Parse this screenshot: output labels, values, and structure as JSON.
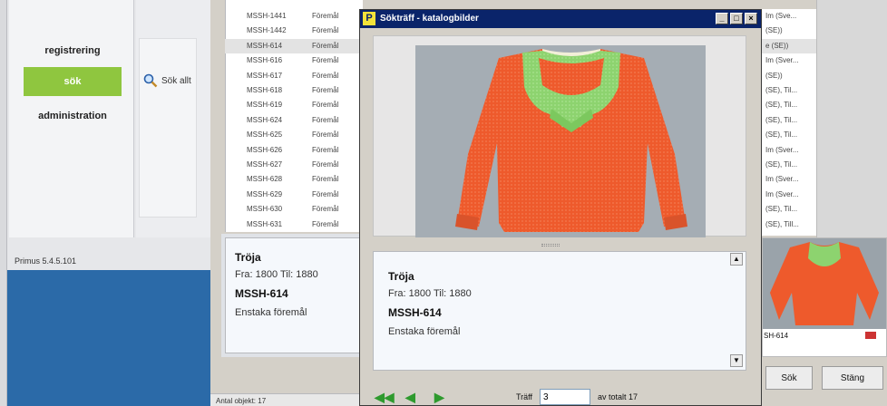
{
  "sidebar": {
    "items": [
      {
        "label": "registrering"
      },
      {
        "label": "sök"
      },
      {
        "label": "administration"
      }
    ],
    "quick_search_label": "Sök allt",
    "version": "Primus 5.4.5.101"
  },
  "list": {
    "rows": [
      {
        "id": "MSSH-1441",
        "type": "Föremål"
      },
      {
        "id": "MSSH-1442",
        "type": "Föremål"
      },
      {
        "id": "MSSH-614",
        "type": "Föremål"
      },
      {
        "id": "MSSH-616",
        "type": "Föremål"
      },
      {
        "id": "MSSH-617",
        "type": "Föremål"
      },
      {
        "id": "MSSH-618",
        "type": "Föremål"
      },
      {
        "id": "MSSH-619",
        "type": "Föremål"
      },
      {
        "id": "MSSH-624",
        "type": "Föremål"
      },
      {
        "id": "MSSH-625",
        "type": "Föremål"
      },
      {
        "id": "MSSH-626",
        "type": "Föremål"
      },
      {
        "id": "MSSH-627",
        "type": "Föremål"
      },
      {
        "id": "MSSH-628",
        "type": "Föremål"
      },
      {
        "id": "MSSH-629",
        "type": "Föremål"
      },
      {
        "id": "MSSH-630",
        "type": "Föremål"
      },
      {
        "id": "MSSH-631",
        "type": "Föremål"
      }
    ],
    "count_label": "Antal objekt: 17"
  },
  "detail": {
    "title": "Tröja",
    "dates": "Fra: 1800 Til: 1880",
    "id": "MSSH-614",
    "type": "Enstaka föremål"
  },
  "right_list": {
    "rows": [
      {
        "text": "Im (Sve..."
      },
      {
        "text": "(SE))"
      },
      {
        "text": "e (SE))"
      },
      {
        "text": "Im (Sver..."
      },
      {
        "text": "(SE))"
      },
      {
        "text": "(SE), Til..."
      },
      {
        "text": "(SE), Til..."
      },
      {
        "text": "(SE), Til..."
      },
      {
        "text": "(SE), Til..."
      },
      {
        "text": "Im (Sver..."
      },
      {
        "text": "(SE), Til..."
      },
      {
        "text": "Im (Sver..."
      },
      {
        "text": "Im (Sver..."
      },
      {
        "text": "(SE), Til..."
      },
      {
        "text": "(SE), Till..."
      }
    ],
    "thumb_id": "SH-614",
    "sok_button": "Sök",
    "stang_button": "Stäng"
  },
  "dialog": {
    "title": "Sökträff - katalogbilder",
    "app_icon_letter": "P",
    "title_buttons": [
      "_",
      "□",
      "×"
    ],
    "description": {
      "title": "Tröja",
      "dates": "Fra: 1800 Til: 1880",
      "id": "MSSH-614",
      "type": "Enstaka föremål"
    },
    "nav": {
      "first": "◀◀",
      "prev": "◀",
      "next": "▶",
      "hit_label": "Träff",
      "hit_value": "3",
      "total_label": "av totalt 17"
    }
  },
  "colors": {
    "sidebar_blue": "#2b6aa8",
    "active_green": "#8fc63f",
    "titlebar": "#0a246a",
    "sweater_orange": "#ee5a2c",
    "sweater_green": "#8dd36f"
  }
}
